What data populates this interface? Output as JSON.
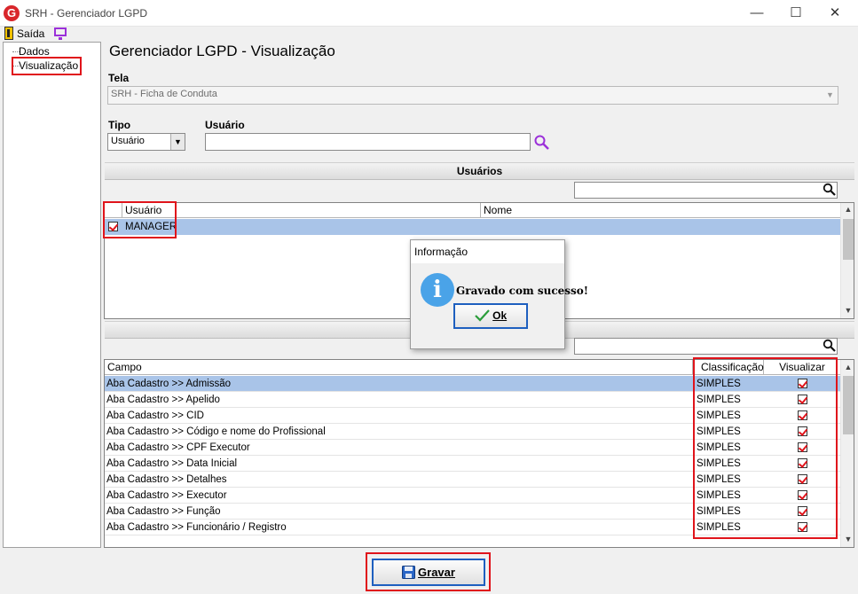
{
  "window": {
    "title": "SRH - Gerenciador LGPD",
    "logo_letter": "G",
    "minimize_glyph": "—",
    "maximize_glyph": "☐",
    "close_glyph": "✕"
  },
  "toolbar": {
    "exit_label": "Saída"
  },
  "tree": {
    "items": [
      {
        "label": "Dados"
      },
      {
        "label": "Visualização",
        "selected": true
      }
    ]
  },
  "page": {
    "title": "Gerenciador LGPD - Visualização"
  },
  "form": {
    "tela_label": "Tela",
    "tela_value": "SRH - Ficha de Conduta",
    "tipo_label": "Tipo",
    "tipo_value": "Usuário",
    "usuario_label": "Usuário",
    "usuario_value": ""
  },
  "users_section": {
    "header": "Usuários",
    "search_value": "",
    "columns": [
      "Usuário",
      "Nome"
    ],
    "rows": [
      {
        "checked": true,
        "usuario": "MANAGER",
        "nome": ""
      }
    ]
  },
  "fields_section": {
    "header": "",
    "search_value": "",
    "columns": [
      "Campo",
      "Classificação",
      "Visualizar"
    ],
    "rows": [
      {
        "campo": "Aba Cadastro >> Admissão",
        "classificacao": "SIMPLES",
        "visualizar": true
      },
      {
        "campo": "Aba Cadastro >> Apelido",
        "classificacao": "SIMPLES",
        "visualizar": true
      },
      {
        "campo": "Aba Cadastro >> CID",
        "classificacao": "SIMPLES",
        "visualizar": true
      },
      {
        "campo": "Aba Cadastro >> Código e nome do Profissional",
        "classificacao": "SIMPLES",
        "visualizar": true
      },
      {
        "campo": "Aba Cadastro >> CPF Executor",
        "classificacao": "SIMPLES",
        "visualizar": true
      },
      {
        "campo": "Aba Cadastro >> Data Inicial",
        "classificacao": "SIMPLES",
        "visualizar": true
      },
      {
        "campo": "Aba Cadastro >> Detalhes",
        "classificacao": "SIMPLES",
        "visualizar": true
      },
      {
        "campo": "Aba Cadastro >> Executor",
        "classificacao": "SIMPLES",
        "visualizar": true
      },
      {
        "campo": "Aba Cadastro >> Função",
        "classificacao": "SIMPLES",
        "visualizar": true
      },
      {
        "campo": "Aba Cadastro >> Funcionário / Registro",
        "classificacao": "SIMPLES",
        "visualizar": true
      }
    ]
  },
  "dialog": {
    "title": "Informação",
    "icon": "info-icon",
    "message": "Gravado com sucesso!",
    "ok_label": "Ok"
  },
  "actions": {
    "gravar_label": "Gravar"
  },
  "colors": {
    "highlight_row": "#a9c4e8",
    "annotation_red": "#e0141b",
    "purple_accent": "#9b30d9"
  }
}
